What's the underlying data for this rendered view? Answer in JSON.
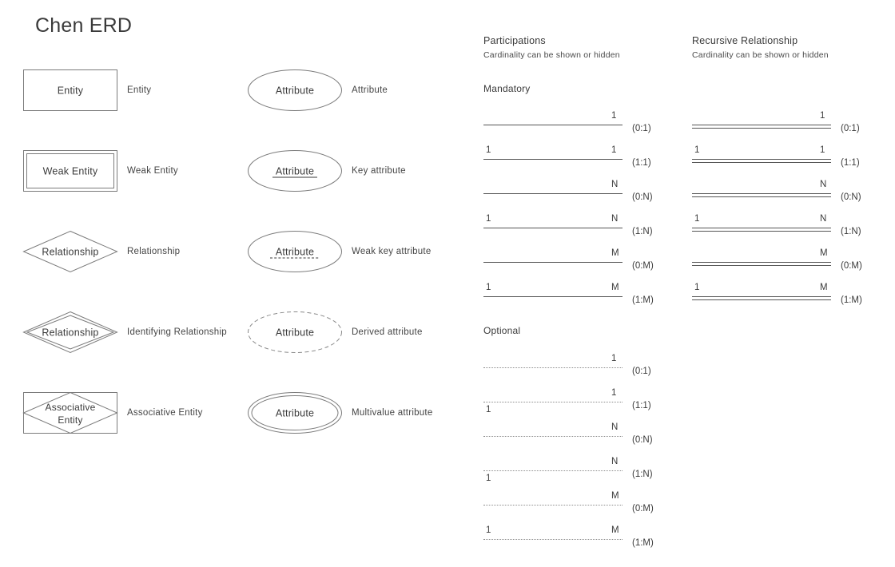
{
  "title": "Chen ERD",
  "colors": {
    "shape_stroke": "#7b7b7b",
    "line_stroke": "#555555",
    "dotted_stroke": "#8d8d8d",
    "text": "#3a3a3a"
  },
  "legend": {
    "entities": [
      {
        "shape": "rectangle",
        "shape_text": "Entity",
        "label": "Entity"
      },
      {
        "shape": "double-rectangle",
        "shape_text": "Weak Entity",
        "label": "Weak Entity"
      },
      {
        "shape": "diamond",
        "shape_text": "Relationship",
        "label": "Relationship"
      },
      {
        "shape": "double-diamond",
        "shape_text": "Relationship",
        "label": "Identifying Relationship"
      },
      {
        "shape": "rect-diamond",
        "shape_text": "Associative Entity",
        "label": "Associative Entity"
      }
    ],
    "attributes": [
      {
        "shape": "ellipse",
        "shape_text": "Attribute",
        "label": "Attribute"
      },
      {
        "shape": "ellipse-underline",
        "shape_text": "Attribute",
        "label": "Key attribute"
      },
      {
        "shape": "ellipse-dashunder",
        "shape_text": "Attribute",
        "label": "Weak key attribute"
      },
      {
        "shape": "ellipse-dashed",
        "shape_text": "Attribute",
        "label": "Derived attribute"
      },
      {
        "shape": "double-ellipse",
        "shape_text": "Attribute",
        "label": "Multivalue attribute"
      }
    ]
  },
  "participations": {
    "title": "Participations",
    "subtitle": "Cardinality can be shown or hidden",
    "mandatory_label": "Mandatory",
    "optional_label": "Optional",
    "mandatory": [
      {
        "left": "",
        "right": "1",
        "note": "(0:1)",
        "left_below": false,
        "right_below": false
      },
      {
        "left": "1",
        "right": "1",
        "note": "(1:1)",
        "left_below": false,
        "right_below": false
      },
      {
        "left": "",
        "right": "N",
        "note": "(0:N)",
        "left_below": false,
        "right_below": false
      },
      {
        "left": "1",
        "right": "N",
        "note": "(1:N)",
        "left_below": false,
        "right_below": false
      },
      {
        "left": "",
        "right": "M",
        "note": "(0:M)",
        "left_below": false,
        "right_below": false
      },
      {
        "left": "1",
        "right": "M",
        "note": "(1:M)",
        "left_below": false,
        "right_below": false
      }
    ],
    "optional": [
      {
        "left": "",
        "right": "1",
        "note": "(0:1)",
        "left_below": false,
        "right_below": false
      },
      {
        "left": "1",
        "right": "1",
        "note": "(1:1)",
        "left_below": true,
        "right_below": false
      },
      {
        "left": "",
        "right": "N",
        "note": "(0:N)",
        "left_below": false,
        "right_below": false
      },
      {
        "left": "1",
        "right": "N",
        "note": "(1:N)",
        "left_below": true,
        "right_below": false
      },
      {
        "left": "",
        "right": "M",
        "note": "(0:M)",
        "left_below": false,
        "right_below": false
      },
      {
        "left": "1",
        "right": "M",
        "note": "(1:M)",
        "left_below": false,
        "right_below": false
      }
    ]
  },
  "recursive": {
    "title": "Recursive Relationship",
    "subtitle": "Cardinality can be shown or hidden",
    "rows": [
      {
        "left": "",
        "right": "1",
        "note": "(0:1)"
      },
      {
        "left": "1",
        "right": "1",
        "note": "(1:1)"
      },
      {
        "left": "",
        "right": "N",
        "note": "(0:N)"
      },
      {
        "left": "1",
        "right": "N",
        "note": "(1:N)"
      },
      {
        "left": "",
        "right": "M",
        "note": "(0:M)"
      },
      {
        "left": "1",
        "right": "M",
        "note": "(1:M)"
      }
    ]
  }
}
